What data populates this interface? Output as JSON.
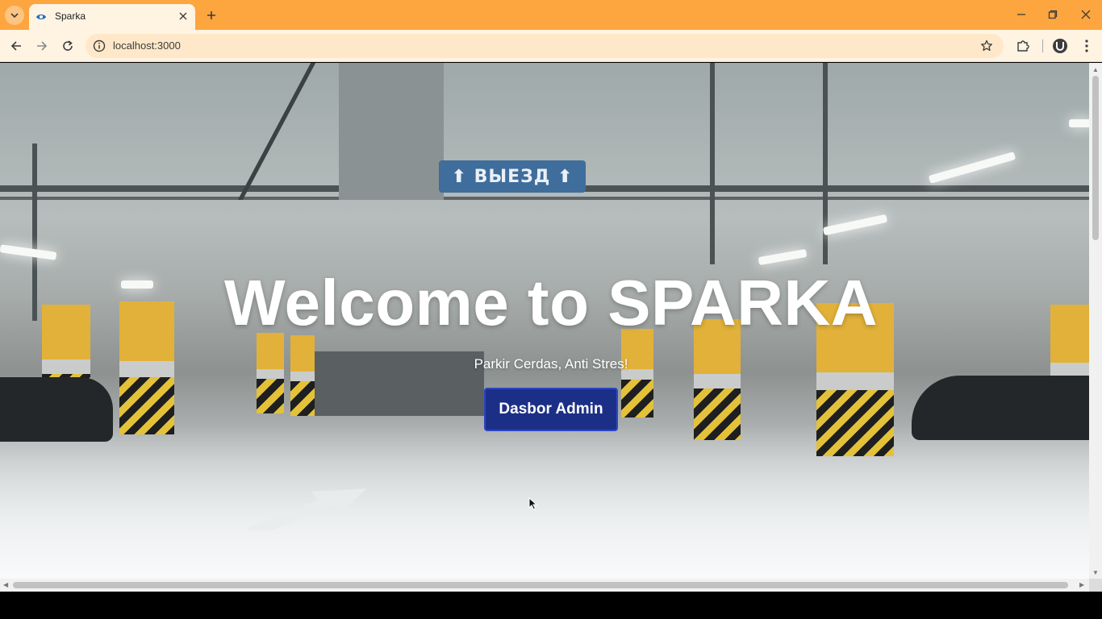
{
  "browser": {
    "tab_title": "Sparka",
    "url": "localhost:3000",
    "accent_color": "#fda53f",
    "icons": {
      "tab_search": "chevron-down-icon",
      "tab_favicon": "sparka-favicon",
      "tab_close": "close-icon",
      "new_tab": "plus-icon",
      "minimize": "minimize-icon",
      "maximize": "restore-icon",
      "close_window": "close-icon",
      "back": "arrow-left-icon",
      "forward": "arrow-right-icon",
      "reload": "reload-icon",
      "site_info": "info-icon",
      "bookmark": "star-icon",
      "extensions": "puzzle-icon",
      "profile": "profile-icon",
      "menu": "kebab-menu-icon"
    }
  },
  "hero": {
    "title": "Welcome to SPARKA",
    "subtitle": "Parkir Cerdas, Anti Stres!",
    "button_label": "Dasbor Admin",
    "button_color": "#1c2f87",
    "sign_text": "⬆ ВЫЕЗД ⬆"
  }
}
